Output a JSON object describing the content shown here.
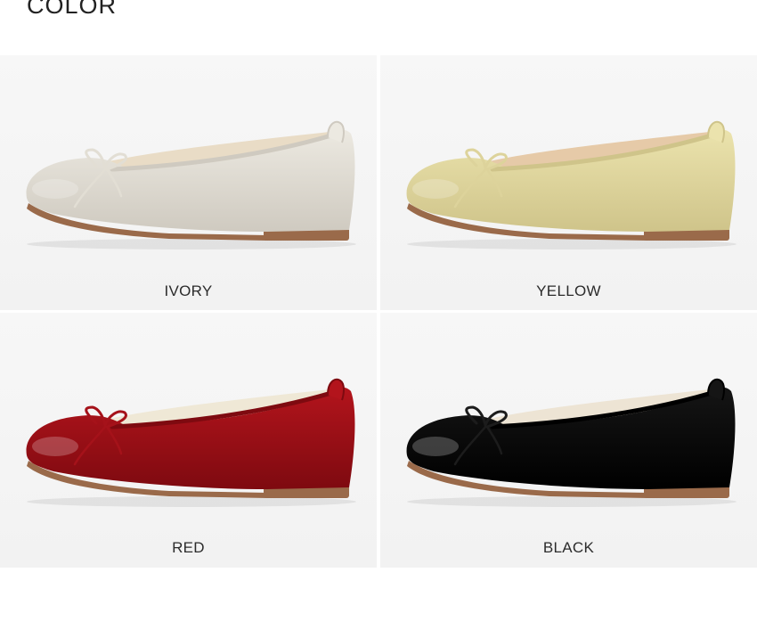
{
  "section": {
    "title": "COLOR"
  },
  "swatches": [
    {
      "label": "IVORY",
      "body": "#ece9e1",
      "shade": "#cfcac0",
      "lining": "#e9dcc6",
      "sole": "#9a6a4a",
      "bow": "#e2ded4"
    },
    {
      "label": "YELLOW",
      "body": "#ebe3ad",
      "shade": "#cfc48a",
      "lining": "#e6caa8",
      "sole": "#9a6a4a",
      "bow": "#ddd39b"
    },
    {
      "label": "RED",
      "body": "#b3141c",
      "shade": "#7e0a10",
      "lining": "#efe8d6",
      "sole": "#9a6a4a",
      "bow": "#a5121a"
    },
    {
      "label": "BLACK",
      "body": "#151515",
      "shade": "#000000",
      "lining": "#ede4d4",
      "sole": "#9a6a4a",
      "bow": "#1c1c1c"
    }
  ]
}
